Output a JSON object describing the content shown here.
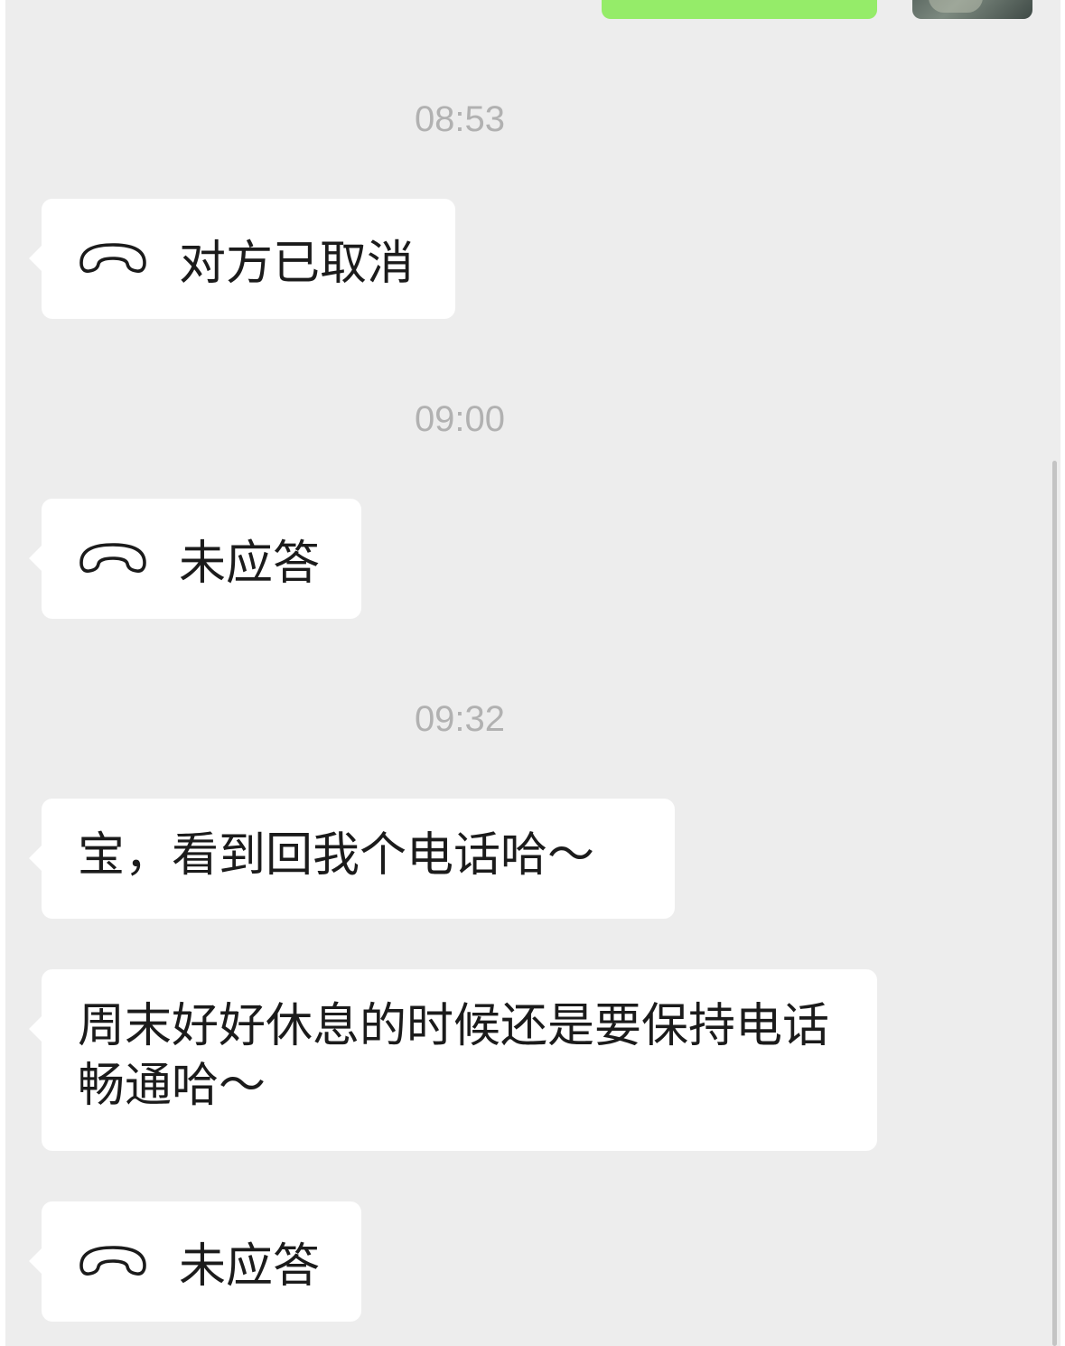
{
  "messages": {
    "outgoing_text": "",
    "time_1": "08:53",
    "call_1_status": "对方已取消",
    "time_2": "09:00",
    "call_2_status": "未应答",
    "time_3": "09:32",
    "text_1": "宝，看到回我个电话哈～",
    "text_2": "周末好好休息的时候还是要保持电话畅通哈～",
    "call_3_status": "未应答"
  },
  "icons": {
    "call": "phone-handset-icon",
    "avatar": "avatar"
  },
  "colors": {
    "chat_background": "#ededed",
    "bubble_incoming": "#ffffff",
    "bubble_outgoing": "#95ec69",
    "timestamp": "#b1b1b1",
    "text": "#1b1b1b"
  }
}
